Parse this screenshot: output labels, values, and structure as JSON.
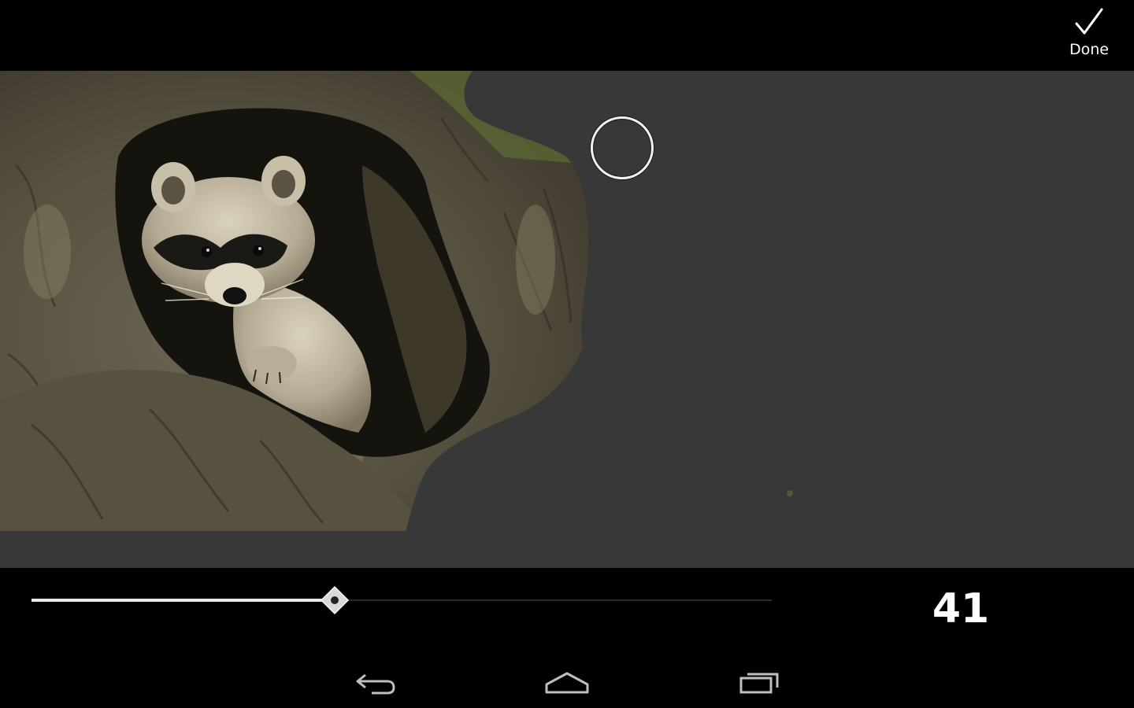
{
  "action_bar": {
    "done_label": "Done",
    "done_icon": "checkmark-icon"
  },
  "editor": {
    "photo_subject": "raccoon-in-tree-hollow",
    "brush_cursor_icon": "circle-brush-cursor",
    "masked_color": "#383838"
  },
  "slider": {
    "value": "41",
    "fraction": 0.41,
    "fill_color": "#e8e8e8",
    "track_color": "#2a2a2a"
  },
  "nav": {
    "back_icon": "back-icon",
    "home_icon": "home-icon",
    "recents_icon": "recent-apps-icon"
  }
}
